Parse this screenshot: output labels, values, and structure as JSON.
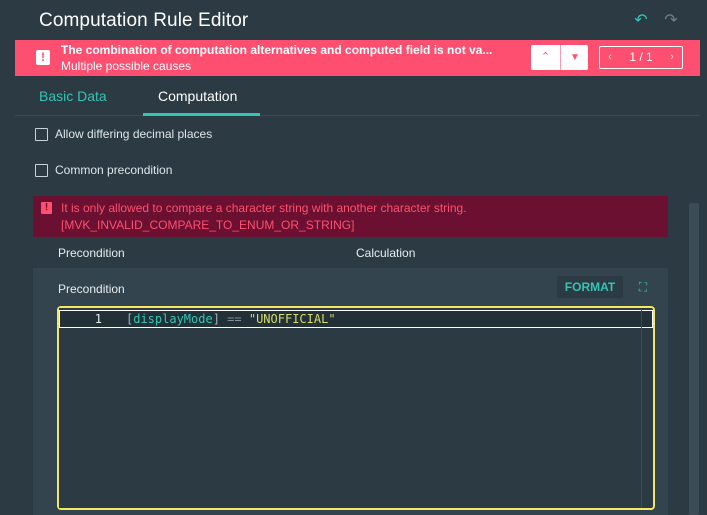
{
  "header": {
    "title": "Computation Rule Editor",
    "undo_icon": "undo-icon",
    "redo_icon": "redo-icon"
  },
  "error_banner": {
    "message": "The combination of computation alternatives and computed field is not va...",
    "sub_message": "Multiple possible causes",
    "icon": "!",
    "pager": "1 / 1",
    "color": "#ff4f70"
  },
  "tabs": [
    {
      "label": "Basic Data",
      "active": false
    },
    {
      "label": "Computation",
      "active": true
    }
  ],
  "checkboxes": [
    {
      "label": "Allow differing decimal places",
      "checked": false
    },
    {
      "label": "Common precondition",
      "checked": false
    }
  ],
  "validation_error": {
    "icon": "!",
    "line1": "It is only allowed to compare a character string with another character string.",
    "line2": "[MVK_INVALID_COMPARE_TO_ENUM_OR_STRING]"
  },
  "columns": {
    "precondition": "Precondition",
    "calculation": "Calculation"
  },
  "expanded": {
    "label": "Precondition",
    "format_button": "FORMAT",
    "code": {
      "line_number": "1",
      "open_bracket": "[",
      "identifier": "displayMode",
      "close_bracket": "]",
      "operator": " == ",
      "string": "\"UNOFFICIAL\""
    }
  },
  "colors": {
    "accent": "#33c5b4",
    "error": "#ff4f70",
    "editor_border": "#f5e663",
    "background": "#2b3a43"
  }
}
